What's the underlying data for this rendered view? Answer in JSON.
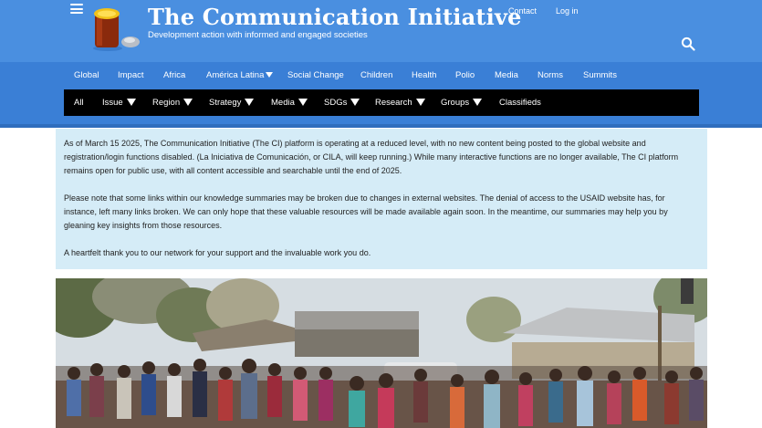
{
  "header": {
    "title": "The Communication Initiative",
    "tagline": "Development action with informed and engaged societies",
    "utility": {
      "contact": "Contact",
      "login": "Log in"
    },
    "menu_icon": "hamburger-icon",
    "search_icon": "search-icon",
    "brand_color": "#4a8fe0"
  },
  "primary_nav": {
    "items": [
      "Global",
      "Impact",
      "Africa",
      "América Latina",
      "Social Change",
      "Children",
      "Health",
      "Polio",
      "Media",
      "Norms",
      "Summits"
    ]
  },
  "secondary_nav": {
    "items": [
      "All",
      "Issue",
      "Region",
      "Strategy",
      "Media",
      "SDGs",
      "Research",
      "Groups",
      "Classifieds"
    ]
  },
  "notice": {
    "paragraphs": [
      "As of March 15 2025, The Communication Initiative (The CI) platform is operating at a reduced level, with no new content being posted to the global website and registration/login functions disabled. (La Iniciativa de Comunicación, or CILA, will keep running.) While many interactive functions are no longer available, The CI platform remains open for public use, with all content accessible and searchable until the end of 2025.",
      "Please note that some links within our knowledge summaries may be broken due to changes in external websites. The denial of access to the USAID website has, for instance, left many links broken. We can only hope that these valuable resources will be made available again soon. In the meantime, our summaries may help you by gleaning key insights from those resources.",
      "A heartfelt thank you to our network for your support and the invaluable work you do."
    ],
    "background": "#d5ecf7"
  }
}
